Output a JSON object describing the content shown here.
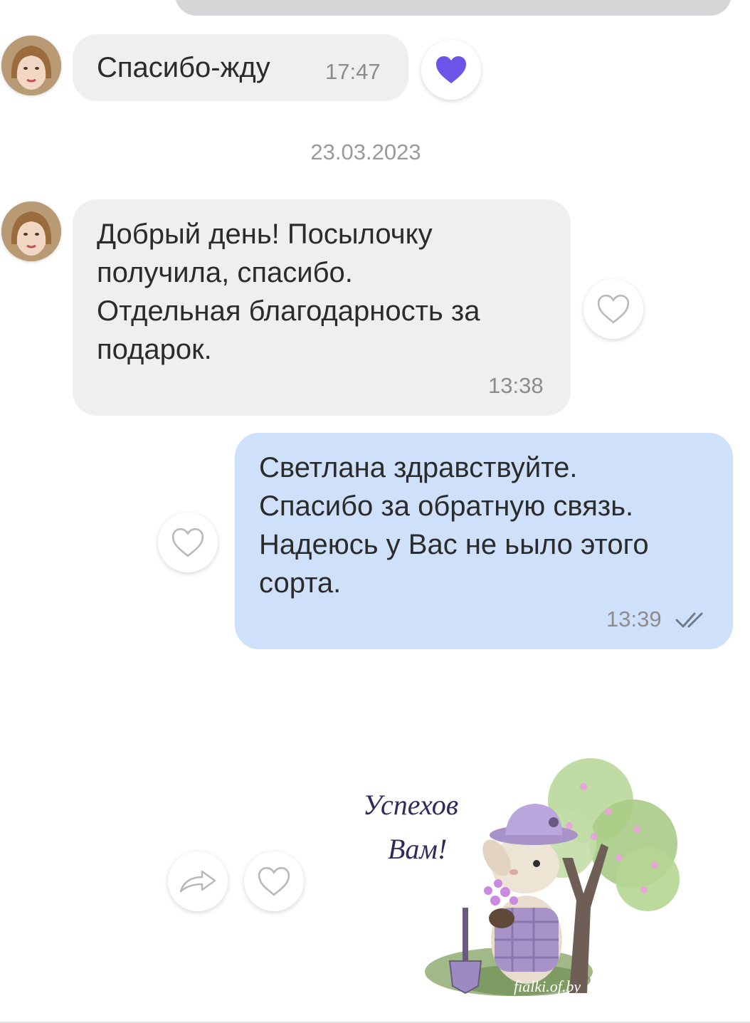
{
  "messages": {
    "m1": {
      "text": "Спасибо-жду",
      "time": "17:47"
    },
    "date_separator": "23.03.2023",
    "m2": {
      "text": "Добрый день! Посылочку\nполучила, спасибо.\nОтдельная благодарность за\nподарок.",
      "time": "13:38"
    },
    "m3": {
      "text": "Светлана здравствуйте.\nСпасибо за обратную связь.\nНадеюсь у Вас не ьыло этого\nсорта.",
      "time": "13:39"
    }
  },
  "sticker": {
    "line1": "Успехов",
    "line2": "Вам!",
    "watermark": "fialki.of.by"
  },
  "colors": {
    "incoming_bubble": "#efefef",
    "outgoing_bubble": "#cfe0fa",
    "liked_heart": "#6b55e8"
  },
  "icons": {
    "liked": "heart-filled-icon",
    "like": "heart-outline-icon",
    "share": "share-arrow-icon",
    "read": "double-check-icon"
  }
}
